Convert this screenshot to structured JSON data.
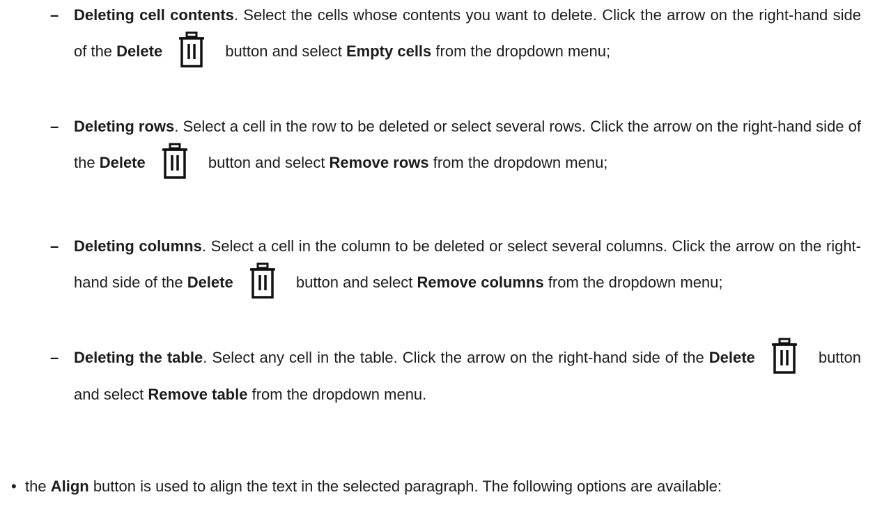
{
  "items": [
    {
      "dash": "–",
      "title": "Deleting cell contents",
      "text1": ". Select the cells whose contents you want to delete. Click the arrow on the right-hand side of the ",
      "delete_label": "Delete",
      "text2": " button and select ",
      "option": "Empty cells",
      "text3": " from the dropdown menu;"
    },
    {
      "dash": "–",
      "title": "Deleting rows",
      "text1": ". Select a cell in the row to be deleted or select several rows. Click the arrow on the right-hand side of the ",
      "delete_label": "Delete",
      "text2": " button and select ",
      "option": "Remove rows",
      "text3": " from the dropdown menu;"
    },
    {
      "dash": "–",
      "title": "Deleting columns",
      "text1": ".  Select a cell in the column to be deleted or select several columns. Click the arrow on the right-hand side of the ",
      "delete_label": "Delete",
      "text2": " button and select ",
      "option": "Remove columns",
      "text3": " from the dropdown menu;"
    },
    {
      "dash": "–",
      "title": "Deleting the table",
      "text1": ". Select any cell in the table. Click the arrow on the right-hand side of the ",
      "delete_label": "Delete",
      "text2": " button and select ",
      "option": "Remove table",
      "text3": " from the dropdown menu."
    }
  ],
  "align": {
    "bullet": "•",
    "pre": "the ",
    "label": "Align",
    "post": " button is used to align the text in the selected paragraph. The following options are available:"
  },
  "icons": {
    "delete": "trash-icon"
  }
}
